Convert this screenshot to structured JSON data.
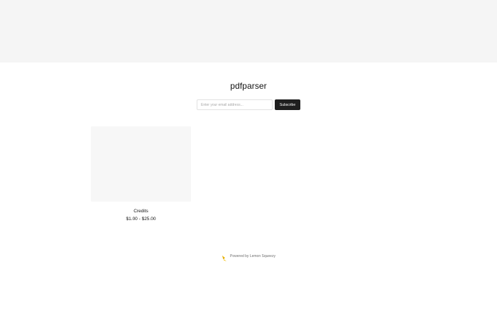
{
  "store": {
    "title": "pdfparser"
  },
  "subscribe": {
    "placeholder": "Enter your email address...",
    "button_label": "Subscribe"
  },
  "products": [
    {
      "name": "Credits",
      "price": "$1.00 - $25.00"
    }
  ],
  "footer": {
    "powered_by": "Powered by Lemon Squeezy",
    "logo_icon": "lemon-squeezy-logo-icon"
  },
  "colors": {
    "banner_bg": "#f5f5f5",
    "button_bg": "#1f1f1f",
    "logo_yellow": "#f5c518"
  }
}
